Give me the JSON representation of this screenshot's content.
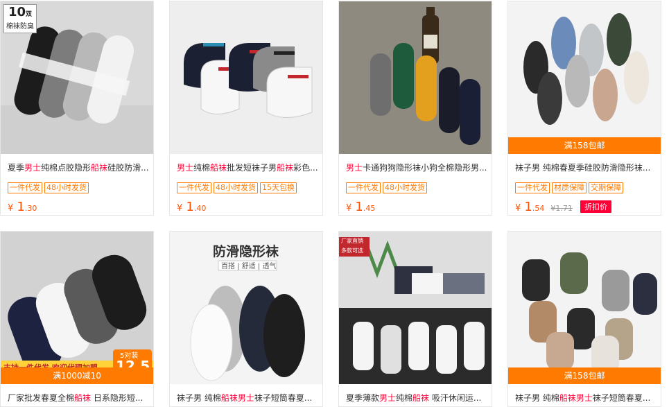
{
  "products": [
    {
      "title_parts": [
        [
          "夏季",
          ""
        ],
        [
          "男士",
          "hl"
        ],
        [
          "纯棉点胶隐形",
          ""
        ],
        [
          "船袜",
          "hl"
        ],
        [
          "硅胶防滑...",
          ""
        ]
      ],
      "tags": [
        "一件代发",
        "48小时发货"
      ],
      "price": {
        "currency": "¥",
        "int": "1",
        "dec": ".30"
      },
      "image": {
        "badge_number": "10",
        "badge_unit": "双",
        "badge_text": "棉袜防臭"
      }
    },
    {
      "title_parts": [
        [
          "男士",
          "hl"
        ],
        [
          "纯棉",
          ""
        ],
        [
          "船袜",
          "hl"
        ],
        [
          "批发短袜子男",
          ""
        ],
        [
          "船袜",
          "hl"
        ],
        [
          "彩色...",
          ""
        ]
      ],
      "tags": [
        "一件代发",
        "48小时发货",
        "15天包换"
      ],
      "price": {
        "currency": "¥",
        "int": "1",
        "dec": ".40"
      }
    },
    {
      "title_parts": [
        [
          "男士",
          "hl"
        ],
        [
          "卡通狗狗隐形袜小狗全棉隐形男...",
          ""
        ]
      ],
      "tags": [
        "一件代发",
        "48小时发货"
      ],
      "price": {
        "currency": "¥",
        "int": "1",
        "dec": ".45"
      }
    },
    {
      "title_parts": [
        [
          "袜子男 纯棉春夏季硅胶防滑隐形袜...",
          ""
        ]
      ],
      "tags": [
        "一件代发",
        "材质保障",
        "交期保障"
      ],
      "price": {
        "currency": "¥",
        "int": "1",
        "dec": ".54",
        "old": "¥1.71"
      },
      "discount_label": "折扣价",
      "banner": "满158包邮"
    },
    {
      "title_parts": [
        [
          "厂家批发春夏全棉",
          ""
        ],
        [
          "船袜",
          "hl"
        ],
        [
          " 日系隐形短...",
          ""
        ]
      ],
      "banner": "满1000减10",
      "image": {
        "promo_text": "支持一件代发 欢迎代理加盟",
        "promo_badge": "5对装",
        "promo_price": "12.5"
      }
    },
    {
      "title_parts": [
        [
          "袜子男 纯棉",
          ""
        ],
        [
          "船袜",
          "hl"
        ],
        [
          "男士",
          "hl"
        ],
        [
          "袜子短筒春夏...",
          ""
        ]
      ],
      "image": {
        "heading": "防滑隐形袜",
        "subheading": "百搭 | 舒适 | 透气"
      }
    },
    {
      "title_parts": [
        [
          "夏季薄款",
          ""
        ],
        [
          "男士",
          "hl"
        ],
        [
          "纯棉",
          ""
        ],
        [
          "船袜",
          "hl"
        ],
        [
          " 吸汗休闲运...",
          ""
        ]
      ],
      "image": {
        "tag_line1": "厂家直销",
        "tag_line2": "多款可选"
      }
    },
    {
      "title_parts": [
        [
          "袜子男 纯棉",
          ""
        ],
        [
          "船袜",
          "hl"
        ],
        [
          "男士",
          "hl"
        ],
        [
          "袜子短筒春夏...",
          ""
        ]
      ],
      "banner": "满158包邮"
    }
  ]
}
